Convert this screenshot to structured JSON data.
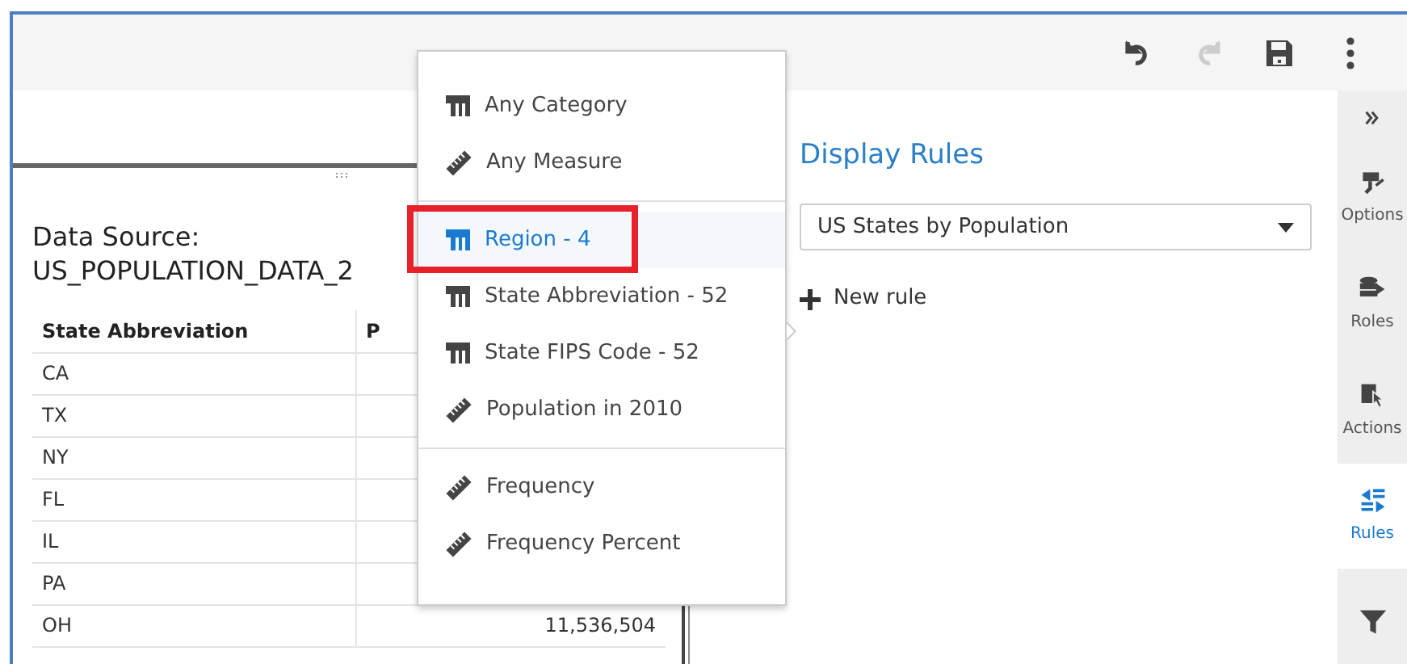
{
  "toolbar": [
    {
      "kind": "undo",
      "disabled": false
    },
    {
      "kind": "redo",
      "disabled": true
    },
    {
      "kind": "save",
      "disabled": false
    },
    {
      "kind": "more",
      "disabled": false
    }
  ],
  "data_panel": {
    "title": "Data Source:",
    "source": "US_POPULATION_DATA_2",
    "columns": [
      "State Abbreviation",
      "P"
    ],
    "rows": [
      [
        "CA",
        ""
      ],
      [
        "TX",
        ""
      ],
      [
        "NY",
        ""
      ],
      [
        "FL",
        ""
      ],
      [
        "IL",
        ""
      ],
      [
        "PA",
        ""
      ],
      [
        "OH",
        "11,536,504"
      ]
    ]
  },
  "menu": {
    "groups": [
      [
        {
          "label": "Any Category",
          "kind": "category",
          "selected": false
        },
        {
          "label": "Any Measure",
          "kind": "measure",
          "selected": false
        }
      ],
      [
        {
          "label": "Region - 4",
          "kind": "category",
          "selected": true
        },
        {
          "label": "State Abbreviation - 52",
          "kind": "category",
          "selected": false
        },
        {
          "label": "State FIPS Code - 52",
          "kind": "category",
          "selected": false
        },
        {
          "label": "Population in 2010",
          "kind": "measure",
          "selected": false
        }
      ],
      [
        {
          "label": "Frequency",
          "kind": "measure",
          "selected": false
        },
        {
          "label": "Frequency Percent",
          "kind": "measure",
          "selected": false
        }
      ]
    ]
  },
  "rules_panel": {
    "title": "Display Rules",
    "dropdown_value": "US States by Population",
    "new_rule": "New rule"
  },
  "sidebar": [
    {
      "kind": "collapse",
      "selected": false
    },
    {
      "kind": "options",
      "label": "Options",
      "selected": false
    },
    {
      "kind": "roles",
      "label": "Roles",
      "selected": false
    },
    {
      "kind": "actions",
      "label": "Actions",
      "selected": false
    },
    {
      "kind": "rules",
      "label": "Rules",
      "selected": true
    },
    {
      "kind": "filters",
      "selected": false
    }
  ]
}
